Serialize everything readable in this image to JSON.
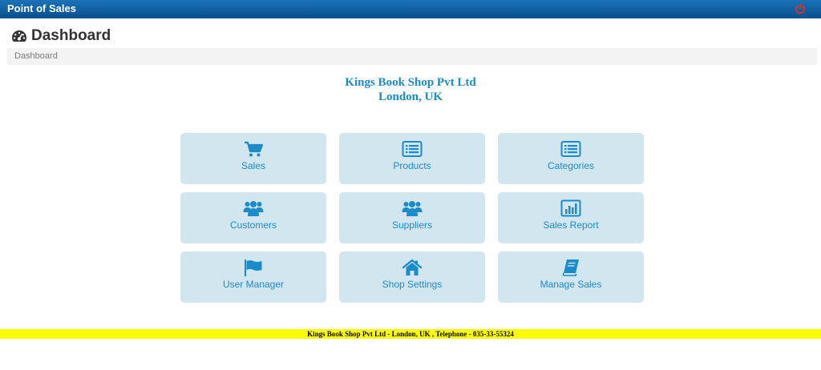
{
  "app": {
    "title": "Point of Sales"
  },
  "page": {
    "title": "Dashboard",
    "breadcrumb": "Dashboard"
  },
  "shop": {
    "name": "Kings Book Shop Pvt Ltd",
    "location": "London, UK"
  },
  "tiles": [
    {
      "label": "Sales",
      "icon": "shopping-cart-icon"
    },
    {
      "label": "Products",
      "icon": "list-icon"
    },
    {
      "label": "Categories",
      "icon": "list-icon"
    },
    {
      "label": "Customers",
      "icon": "users-icon"
    },
    {
      "label": "Suppliers",
      "icon": "users-icon"
    },
    {
      "label": "Sales Report",
      "icon": "bar-chart-icon"
    },
    {
      "label": "User Manager",
      "icon": "flag-icon"
    },
    {
      "label": "Shop Settings",
      "icon": "home-icon"
    },
    {
      "label": "Manage Sales",
      "icon": "book-icon"
    }
  ],
  "footer": {
    "text": "Kings Book Shop Pvt Ltd - London, UK , Telephone - 035-33-55324"
  },
  "colors": {
    "accent": "#1b8bc9",
    "tile_bg": "#d2e6f0",
    "topbar": "#0a4f8c",
    "footer_bg": "#ffff00",
    "power": "#e0302a"
  },
  "icons": {
    "power": "power-icon",
    "dashboard": "dashboard-gauge-icon"
  }
}
